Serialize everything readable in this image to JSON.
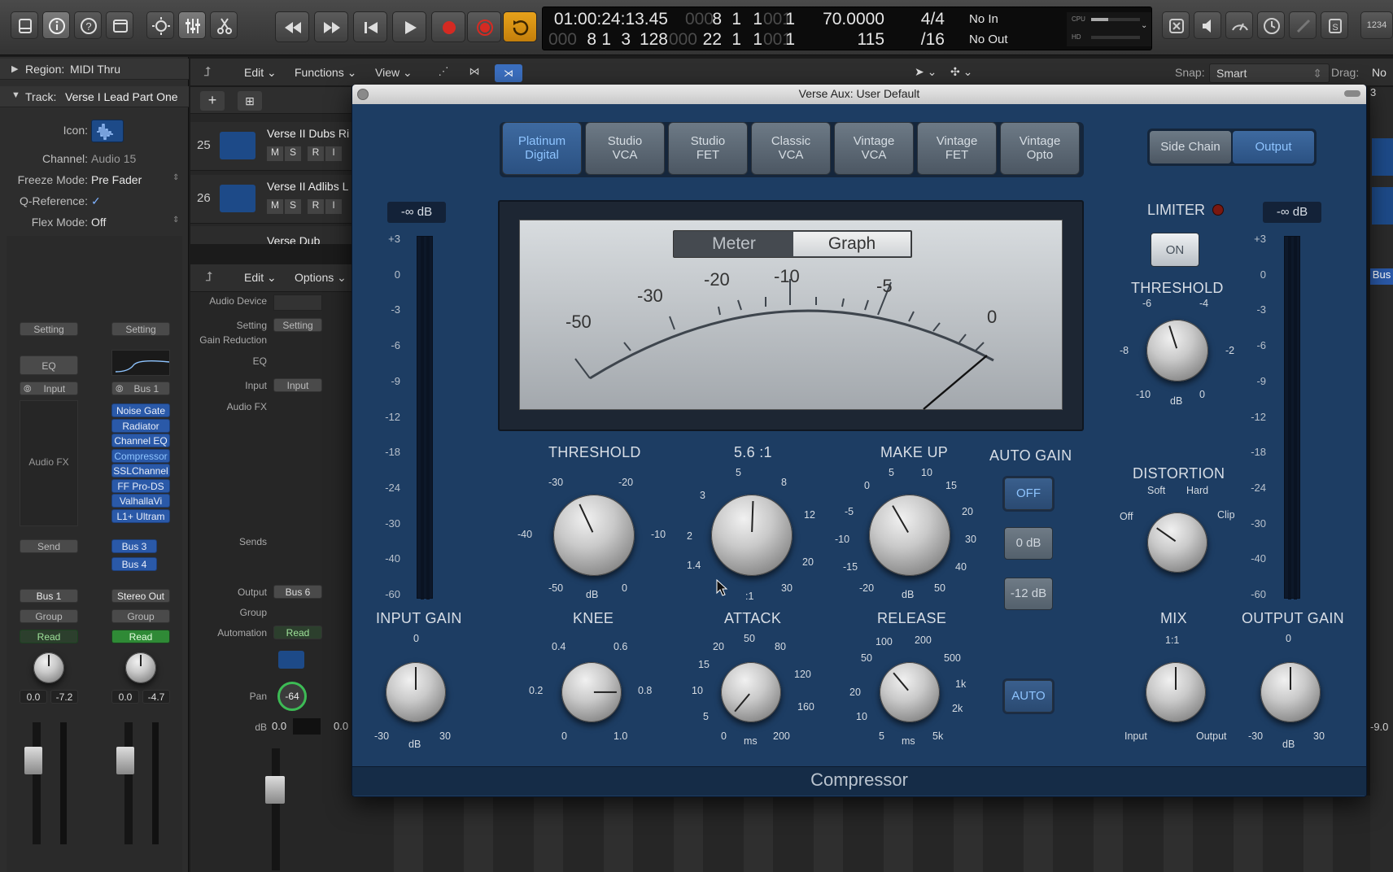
{
  "transport": {
    "lcd": {
      "time": "01:00:24:13.45",
      "bars_top": [
        "8",
        "1",
        "1"
      ],
      "bars_top_dim": [
        "000",
        "001"
      ],
      "bars_top_last": "1",
      "bars_bottom": [
        "8",
        "1",
        "3",
        "128"
      ],
      "bars_bottom_dim": "000",
      "len_bottom": [
        "22",
        "1",
        "1"
      ],
      "len_bottom_dim": [
        "000",
        "001"
      ],
      "len_bottom_last": "1",
      "tempo": "70.0000",
      "tempo_sub": "115",
      "sig": "4/4",
      "div": "/16",
      "midi_in": "No In",
      "midi_out": "No Out",
      "cpu": "CPU",
      "hd": "HD",
      "user": "1234"
    }
  },
  "colors": {
    "record": "#d52a22",
    "cycle": "#e8a21b",
    "plugin_bg": "#1d3d63",
    "accent": "#8ec4ff"
  },
  "inspector": {
    "region_label": "Region:",
    "region_value": "MIDI Thru",
    "track_label": "Track:",
    "track_value": "Verse I Lead Part One",
    "rows": [
      {
        "label": "Icon:",
        "value": ""
      },
      {
        "label": "Channel:",
        "value": "Audio 15"
      },
      {
        "label": "Freeze Mode:",
        "value": "Pre Fader"
      },
      {
        "label": "Q-Reference:",
        "value": "✓"
      },
      {
        "label": "Flex Mode:",
        "value": "Off"
      }
    ]
  },
  "strips": {
    "setting": "Setting",
    "eq": "EQ",
    "input": "Input",
    "bus1": "Bus 1",
    "audio_fx": "Audio FX",
    "plugins": [
      "Noise Gate",
      "Radiator",
      "Channel EQ",
      "Compressor",
      "SSLChannel",
      "FF Pro-DS",
      "ValhallaVi",
      "L1+ Ultram"
    ],
    "send": "Send",
    "bus3": "Bus 3",
    "bus4": "Bus 4",
    "out1": "Bus 1",
    "out2": "Stereo Out",
    "group": "Group",
    "read": "Read",
    "vol1": "0.0",
    "pk1": "-7.2",
    "vol2": "0.0",
    "pk2": "-4.7"
  },
  "tracks": {
    "menu": [
      "Edit",
      "Functions",
      "View"
    ],
    "list": [
      {
        "num": "25",
        "name": "Verse II Dubs Ri",
        "btns": [
          "M",
          "S",
          "R",
          "I"
        ]
      },
      {
        "num": "26",
        "name": "Verse II Adlibs L",
        "btns": [
          "M",
          "S",
          "R",
          "I"
        ]
      },
      {
        "num": "",
        "name": "Verse Dub",
        "btns": []
      }
    ],
    "snap_label": "Snap:",
    "snap_value": "Smart",
    "drag_label": "Drag:",
    "drag_value": "No"
  },
  "mixer": {
    "menu": [
      "Edit",
      "Options"
    ],
    "labels": [
      "Audio Device",
      "Setting",
      "Gain Reduction",
      "EQ",
      "Input",
      "Audio FX",
      "Sends",
      "Output",
      "Group",
      "Automation",
      "Pan",
      "dB"
    ],
    "setting": "Setting",
    "input": "Input",
    "output": "Bus 6",
    "automation": "Read",
    "pan": "-64",
    "db": "0.0",
    "db2": "0.0",
    "right_bus": "Bus",
    "right_db": "-9.0"
  },
  "plugin": {
    "window_title": "Verse Aux: User Default",
    "presets": [
      "Platinum\nDigital",
      "Studio\nVCA",
      "Studio\nFET",
      "Classic\nVCA",
      "Vintage\nVCA",
      "Vintage\nFET",
      "Vintage\nOpto"
    ],
    "side_chain": "Side Chain",
    "output": "Output",
    "in_level": "-∞ dB",
    "out_level": "-∞ dB",
    "meter_scale": [
      "+3",
      "0",
      "-3",
      "-6",
      "-9",
      "-12",
      "-18",
      "-24",
      "-30",
      "-40",
      "-60"
    ],
    "meter_tab": "Meter",
    "graph_tab": "Graph",
    "vu_labels": [
      "-50",
      "-30",
      "-20",
      "-10",
      "-5",
      "0"
    ],
    "limiter": "LIMITER",
    "limiter_on": "ON",
    "lim_threshold": "THRESHOLD",
    "lim_scale": [
      "-6",
      "-4",
      "-8",
      "-2",
      "-10",
      "dB",
      "0"
    ],
    "threshold": {
      "title": "THRESHOLD",
      "scale": [
        "-30",
        "-20",
        "-40",
        "-10",
        "-50",
        "dB",
        "0"
      ]
    },
    "ratio": {
      "title": "5.6 :1",
      "scale": [
        "5",
        "8",
        "3",
        "12",
        "2",
        "20",
        "1.4",
        "30",
        ":1"
      ]
    },
    "makeup": {
      "title": "MAKE UP",
      "scale": [
        "5",
        "10",
        "0",
        "15",
        "-5",
        "20",
        "-10",
        "30",
        "-15",
        "40",
        "-20",
        "dB",
        "50"
      ]
    },
    "auto_gain": "AUTO GAIN",
    "ag_off": "OFF",
    "ag_0": "0 dB",
    "ag_12": "-12 dB",
    "auto": "AUTO",
    "distortion": {
      "title": "DISTORTION",
      "scale": [
        "Soft",
        "Hard",
        "Off",
        "Clip"
      ]
    },
    "input_gain": {
      "title": "INPUT GAIN",
      "scale": [
        "0",
        "-30",
        "dB",
        "30"
      ]
    },
    "knee": {
      "title": "KNEE",
      "scale": [
        "0.4",
        "0.6",
        "0.2",
        "0.8",
        "0",
        "1.0"
      ]
    },
    "attack": {
      "title": "ATTACK",
      "scale": [
        "50",
        "20",
        "80",
        "15",
        "120",
        "10",
        "160",
        "5",
        "0",
        "ms",
        "200"
      ]
    },
    "release": {
      "title": "RELEASE",
      "scale": [
        "100",
        "200",
        "50",
        "500",
        "20",
        "1k",
        "10",
        "2k",
        "5",
        "ms",
        "5k"
      ]
    },
    "mix": {
      "title": "MIX",
      "scale": [
        "1:1",
        "Input",
        "Output"
      ]
    },
    "output_gain": {
      "title": "OUTPUT GAIN",
      "scale": [
        "0",
        "-30",
        "dB",
        "30"
      ]
    },
    "footer": "Compressor"
  }
}
